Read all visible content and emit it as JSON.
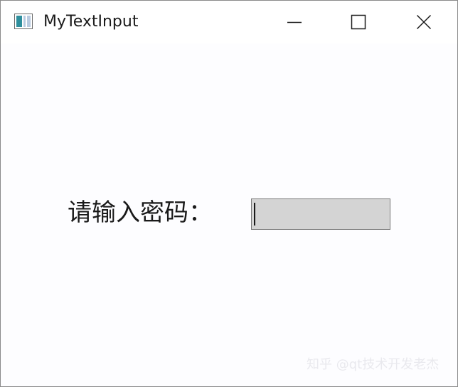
{
  "window": {
    "title": "MyTextInput"
  },
  "titlebar_buttons": {
    "minimize_icon": "minimize-icon",
    "maximize_icon": "maximize-icon",
    "close_icon": "close-icon"
  },
  "form": {
    "password_label": "请输入密码：",
    "password_value": ""
  },
  "watermark": {
    "text": "知乎 @qt技术开发老杰"
  },
  "colors": {
    "input_background": "#d4d4d4",
    "window_background": "#fdfdff",
    "text": "#1a1a1a"
  }
}
